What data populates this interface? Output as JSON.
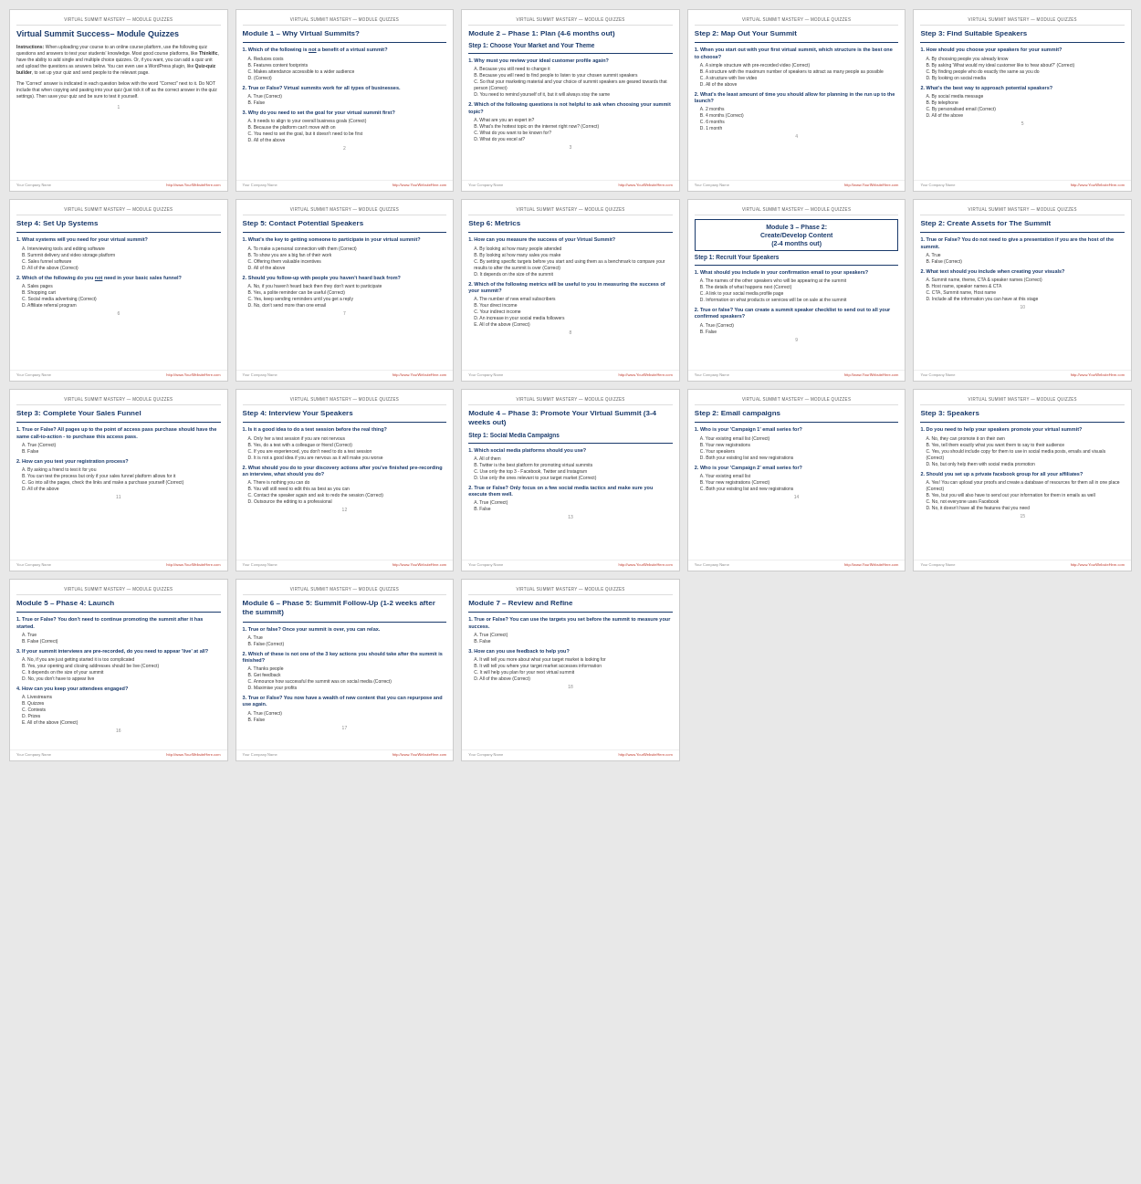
{
  "brand": "VIRTUAL SUMMIT MASTERY — MODULE QUIZZES",
  "accent": "#1a3a6b",
  "pages": [
    {
      "id": 1,
      "header": "VIRTUAL SUMMIT MASTERY — MODULE QUIZZES",
      "title": "Virtual Summit Success– Module Quizzes",
      "has_instructions": true,
      "instructions": "Instructions: When uploading your course to an online course platform, use the following quiz questions and answers to test your students' knowledge. Most good course platforms, like Thinkific, have the ability to add single and multiple choice quizzes. Or, if you want, you can add a quiz unit and upload the questions as answers below. You can even use a WordPress plugin, like Quiz-quiz builder, to set up your quiz and send people to the relevant page.",
      "instructions2": "The 'Correct' answer is indicated in each question below with the word \"Correct\" next to it. Do NOT include that when copying and pasting into your quiz (just tick it off as the correct answer in the quiz settings). Then save your quiz and be sure to test it yourself.",
      "questions": [],
      "page_num": "1"
    },
    {
      "id": 2,
      "header": "VIRTUAL SUMMIT MASTERY — MODULE QUIZZES",
      "title": "Module 1 – Why Virtual Summits?",
      "questions": [
        {
          "num": "1.",
          "text": "Which of the following is not a benefit of a virtual summit?",
          "answers": [
            "A. Reduces costs",
            "B. Features content footprints",
            "C. Makes attendance accessible to a wider audience",
            "D. (Correct)"
          ]
        },
        {
          "num": "2.",
          "text": "True or False? Virtual summits work for all types of businesses.",
          "answers": [
            "A. True (Correct)",
            "B. False"
          ]
        },
        {
          "num": "3.",
          "text": "Why do you need to set the goal for your virtual summit first?",
          "answers": [
            "A. It needs to align to your overall business goals (Correct)",
            "B. Because the platform can't move with on",
            "C. You need to set the goal, but it doesn't need to be first",
            "D. All of the above"
          ]
        }
      ],
      "page_num": "2"
    },
    {
      "id": 3,
      "header": "VIRTUAL SUMMIT MASTERY — MODULE QUIZZES",
      "title": "Module 2 – Phase 1: Plan (4-6 months out)",
      "step": "Step 1: Choose Your Market and Your Theme",
      "questions": [
        {
          "num": "1.",
          "text": "Why must you review your ideal customer profile again?",
          "answers": [
            "A. Because you still need to change it",
            "B. Because you will need to find people to listen to your chosen summit speakers",
            "C. So that your marketing material and your choice of summit speakers are geared towards that person (Correct)",
            "D. You need to remind yourself of it, but it will always stay the same"
          ]
        },
        {
          "num": "2.",
          "text": "Which of the following questions is not helpful to ask when choosing your summit topic?",
          "answers": [
            "A. What are you an expert in?",
            "B. What's the hottest topic on the internet right now? (Correct)",
            "C. What do you want to be known for?",
            "D. What do you excel at?"
          ]
        }
      ],
      "page_num": "3"
    },
    {
      "id": 4,
      "header": "VIRTUAL SUMMIT MASTERY — MODULE QUIZZES",
      "title": "Step 2: Map Out Your Summit",
      "questions": [
        {
          "num": "1.",
          "text": "When you start out with your first virtual summit, which structure is the best one to choose?",
          "answers": [
            "A. A simple structure with pre-recorded video (Correct)",
            "B. A structure with the maximum number of speakers to attract as many people as possible",
            "C. A structure with live video",
            "D. All of the above"
          ]
        },
        {
          "num": "2.",
          "text": "What's the least amount of time you should allow for planning in the run up to the launch?",
          "answers": [
            "A. 2 months",
            "B. 4 months (Correct)",
            "C. 6 months",
            "D. 1 month"
          ]
        }
      ],
      "page_num": "4"
    },
    {
      "id": 5,
      "header": "VIRTUAL SUMMIT MASTERY — MODULE QUIZZES",
      "title": "Step 3: Find Suitable Speakers",
      "questions": [
        {
          "num": "1.",
          "text": "How should you choose your speakers for your summit?",
          "answers": [
            "A. By choosing people you already know",
            "B. By asking 'What would my ideal customer like to hear about?' (Correct)",
            "C. By finding people who do exactly the same as you do",
            "D. By looking on social media"
          ]
        },
        {
          "num": "2.",
          "text": "What's the best way to approach potential speakers?",
          "answers": [
            "A. By social media message",
            "B. By telephone",
            "C. By personalised email (Correct)",
            "D. All of the above"
          ]
        }
      ],
      "page_num": "5"
    },
    {
      "id": 6,
      "header": "VIRTUAL SUMMIT MASTERY — MODULE QUIZZES",
      "title": "Step 4: Set Up Systems",
      "questions": [
        {
          "num": "1.",
          "text": "What systems will you need for your virtual summit?",
          "answers": [
            "A. Interviewing tools and editing software",
            "B. Summit delivery and video storage platform",
            "C. Sales funnel software",
            "D. All of the above (Correct)"
          ]
        },
        {
          "num": "2.",
          "text": "Which of the following do you not need in your basic sales funnel?",
          "answers": [
            "A. Sales pages",
            "B. Shopping cart",
            "C. Social media advertising (Correct)",
            "D. Affiliate referral program"
          ]
        }
      ],
      "page_num": "6"
    },
    {
      "id": 7,
      "header": "VIRTUAL SUMMIT MASTERY — MODULE QUIZZES",
      "title": "Step 5: Contact Potential Speakers",
      "questions": [
        {
          "num": "1.",
          "text": "What's the key to getting someone to participate in your virtual summit?",
          "answers": [
            "A. To make a personal connection with them (Correct)",
            "B. To show you are a big fan of their work",
            "C. Offering them valuable incentives",
            "D. All of the above"
          ]
        },
        {
          "num": "2.",
          "text": "Should you follow-up with people you haven't heard back from?",
          "answers": [
            "A. No, if you haven't heard back then they don't want to participate",
            "B. Yes, a polite reminder can be useful (Correct)",
            "C. Yes, keep sending reminders until you get a reply",
            "D. No, don't send more than one email"
          ]
        }
      ],
      "page_num": "7"
    },
    {
      "id": 8,
      "header": "VIRTUAL SUMMIT MASTERY — MODULE QUIZZES",
      "title": "Step 6: Metrics",
      "questions": [
        {
          "num": "1.",
          "text": "How can you measure the success of your Virtual Summit?",
          "answers": [
            "A. By looking at how many people attended",
            "B. By looking at how many sales you make",
            "C. By setting specific targets before you start and using them as a benchmark to compare your results to after the summit is over (Correct)",
            "D. It depends on the size of the summit"
          ]
        },
        {
          "num": "2.",
          "text": "Which of the following metrics will be useful to you in measuring the success of your summit?",
          "answers": [
            "A. The number of new email subscribers",
            "B. Your direct income",
            "C. Your indirect income",
            "D. An increase in your social media followers",
            "E. All of the above (Correct)"
          ]
        }
      ],
      "page_num": "8"
    },
    {
      "id": 9,
      "header": "VIRTUAL SUMMIT MASTERY — MODULE QUIZZES",
      "title": "Module 3 – Phase 2: Create/Develop Content (2-4 months out)",
      "step": "Step 1: Recruit Your Speakers",
      "phase_box": true,
      "questions": [
        {
          "num": "1.",
          "text": "What should you include in your confirmation email to your speakers?",
          "answers": [
            "A. The names of the other speakers who will be appearing at the summit",
            "B. The details of what happens next (Correct)",
            "C. A link to your social media profile page",
            "D. Information on what products or services will be on sale at the summit"
          ]
        },
        {
          "num": "2.",
          "text": "True or false? You can create a summit speaker checklist to send out to all your confirmed speakers?",
          "answers": [
            "A. True (Correct)",
            "B. False"
          ]
        }
      ],
      "page_num": "9"
    },
    {
      "id": 10,
      "header": "VIRTUAL SUMMIT MASTERY — MODULE QUIZZES",
      "title": "Step 2: Create Assets for The Summit",
      "questions": [
        {
          "num": "1.",
          "text": "True or False? You do not need to give a presentation if you are the host of the summit.",
          "answers": [
            "A. True",
            "B. False (Correct)"
          ]
        },
        {
          "num": "2.",
          "text": "What text should you include when creating your visuals?",
          "answers": [
            "A. Summit name, theme, CTA & speaker names (Correct)",
            "B. Host name, speaker names & CTA",
            "C. CTA, Summit name, Host name",
            "D. Include all the information you can have at this stage"
          ]
        }
      ],
      "page_num": "10"
    },
    {
      "id": 11,
      "header": "VIRTUAL SUMMIT MASTERY — MODULE QUIZZES",
      "title": "Step 3: Complete Your Sales Funnel",
      "questions": [
        {
          "num": "1.",
          "text": "True or False? All pages up to the point of access pass purchase should have the same call-to-action - to purchase this access pass.",
          "answers": [
            "A. True (Correct)",
            "B. False"
          ]
        },
        {
          "num": "2.",
          "text": "How can you test your registration process?",
          "answers": [
            "A. By asking a friend to test it for you",
            "B. You can test the process but only if your sales funnel platform allows for it",
            "C. Go into all the pages, check the links and make a purchase yourself (Correct)",
            "D. All of the above"
          ]
        }
      ],
      "page_num": "11"
    },
    {
      "id": 12,
      "header": "VIRTUAL SUMMIT MASTERY — MODULE QUIZZES",
      "title": "Step 4: Interview Your Speakers",
      "questions": [
        {
          "num": "1.",
          "text": "Is it a good idea to do a test session before the real thing?",
          "answers": [
            "A. Only her a test session if you are not nervous",
            "B. Yes, do a test with a colleague or friend (Correct)",
            "C. If you are experienced, you don't need to do a test session",
            "D. It is not a good idea if you are nervous as it will make you worse"
          ]
        },
        {
          "num": "2.",
          "text": "What should you do to your discovery actions after you've finished pre-recording an interview, what should you do?",
          "answers": [
            "A. There is nothing you can do",
            "B. You will still need to edit this as best as you can",
            "C. Contact the speaker again and ask to redo the session (Correct)",
            "D. Outsource the editing to a professional"
          ]
        }
      ],
      "page_num": "12"
    },
    {
      "id": 13,
      "header": "VIRTUAL SUMMIT MASTERY — MODULE QUIZZES",
      "title": "Module 4 – Phase 3: Promote Your Virtual Summit (3-4 weeks out)",
      "step": "Step 1: Social Media Campaigns",
      "questions": [
        {
          "num": "1.",
          "text": "Which social media platforms should you use?",
          "answers": [
            "A. All of them",
            "B. Twitter is the best platform for promoting virtual summits",
            "C. Use only the top 3 - Facebook, Twitter and Instagram",
            "D. Use only the ones relevant to your target market (Correct)"
          ]
        },
        {
          "num": "2.",
          "text": "True or False? Only focus on a few social media tactics and make sure you execute them well.",
          "answers": [
            "A. True (Correct)",
            "B. False"
          ]
        }
      ],
      "page_num": "13"
    },
    {
      "id": 14,
      "header": "VIRTUAL SUMMIT MASTERY — MODULE QUIZZES",
      "title": "Step 2: Email campaigns",
      "questions": [
        {
          "num": "1.",
          "text": "Who is your 'Campaign 1' email series for?",
          "answers": [
            "A. Your existing email list (Correct)",
            "B. Your new registrations",
            "C. Your speakers",
            "D. Both your existing list and new registrations"
          ]
        },
        {
          "num": "2.",
          "text": "Who is your 'Campaign 2' email series for?",
          "answers": [
            "A. Your existing email list",
            "B. Your new registrations (Correct)",
            "C. Both your existing list and new registrations"
          ]
        }
      ],
      "page_num": "14"
    },
    {
      "id": 15,
      "header": "VIRTUAL SUMMIT MASTERY — MODULE QUIZZES",
      "title": "Step 3: Speakers",
      "questions": [
        {
          "num": "1.",
          "text": "Do you need to help your speakers promote your virtual summit?",
          "answers": [
            "A. No, they can promote it on their own",
            "B. Yes, tell them exactly what you want them to say to their audience",
            "C. Yes, you should include copy for them to use in social media posts, emails and visuals (Correct)",
            "D. No, but only help them with social media promotion"
          ]
        },
        {
          "num": "2.",
          "text": "Should you set up a private facebook group for all your affiliates?",
          "answers": [
            "A. Yes! You can upload your proofs and create a database of resources for them all in one place (Correct)",
            "B. Yes, but you will also have to send out your information for them in emails as well",
            "C. No, not everyone uses Facebook",
            "D. No, it doesn't have all the features that you need"
          ]
        }
      ],
      "page_num": "15"
    },
    {
      "id": 16,
      "header": "VIRTUAL SUMMIT MASTERY — MODULE QUIZZES",
      "title": "Module 5 – Phase 4: Launch",
      "questions": [
        {
          "num": "1.",
          "text": "True or False? You don't need to continue promoting the summit after it has started.",
          "answers": [
            "A. True",
            "B. False (Correct)"
          ]
        },
        {
          "num": "3.",
          "text": "If your summit interviews are pre-recorded, do you need to appear 'live' at all?",
          "answers": [
            "A. No, if you are just getting started it is too complicated",
            "B. Yes, your opening and closing addresses should be live (Correct)",
            "C. It depends on the size of your summit",
            "D. No, you don't have to appear live"
          ]
        },
        {
          "num": "4.",
          "text": "How can you keep your attendees engaged?",
          "answers": [
            "A. Livestreams",
            "B. Quizzes",
            "C. Contests",
            "D. Prizes",
            "E. All of the above (Correct)"
          ]
        }
      ],
      "page_num": "16"
    },
    {
      "id": 17,
      "header": "VIRTUAL SUMMIT MASTERY — MODULE QUIZZES",
      "title": "Module 6 – Phase 5: Summit Follow-Up (1-2 weeks after the summit)",
      "questions": [
        {
          "num": "1.",
          "text": "True or false? Once your summit is over, you can relax.",
          "answers": [
            "A. True",
            "B. False (Correct)"
          ]
        },
        {
          "num": "2.",
          "text": "Which of these is not one of the 3 key actions you should take after the summit is finished?",
          "answers": [
            "A. Thanks people",
            "B. Get feedback",
            "C. Announce how successful the summit was on social media (Correct)",
            "D. Maximise your profits"
          ]
        },
        {
          "num": "3.",
          "text": "True or False? You now have a wealth of new content that you can repurpose and use again.",
          "answers": [
            "A. True (Correct)",
            "B. False"
          ]
        }
      ],
      "page_num": "17"
    },
    {
      "id": 18,
      "header": "VIRTUAL SUMMIT MASTERY — MODULE QUIZZES",
      "title": "Module 7 – Review and Refine",
      "questions": [
        {
          "num": "1.",
          "text": "True or False? You can use the targets you set before the summit to measure your success.",
          "answers": [
            "A. True (Correct)",
            "B. False"
          ]
        },
        {
          "num": "3.",
          "text": "How can you use feedback to help you?",
          "answers": [
            "A. It will tell you more about what your target market is looking for",
            "B. It will tell you where your target market accesses information",
            "C. It will help you plan for your next virtual summit",
            "D. All of the above (Correct)"
          ]
        }
      ],
      "page_num": "18"
    }
  ],
  "footer_left": "Your Company Name",
  "footer_right_label": "http://www.YourWebsiteHere.com"
}
